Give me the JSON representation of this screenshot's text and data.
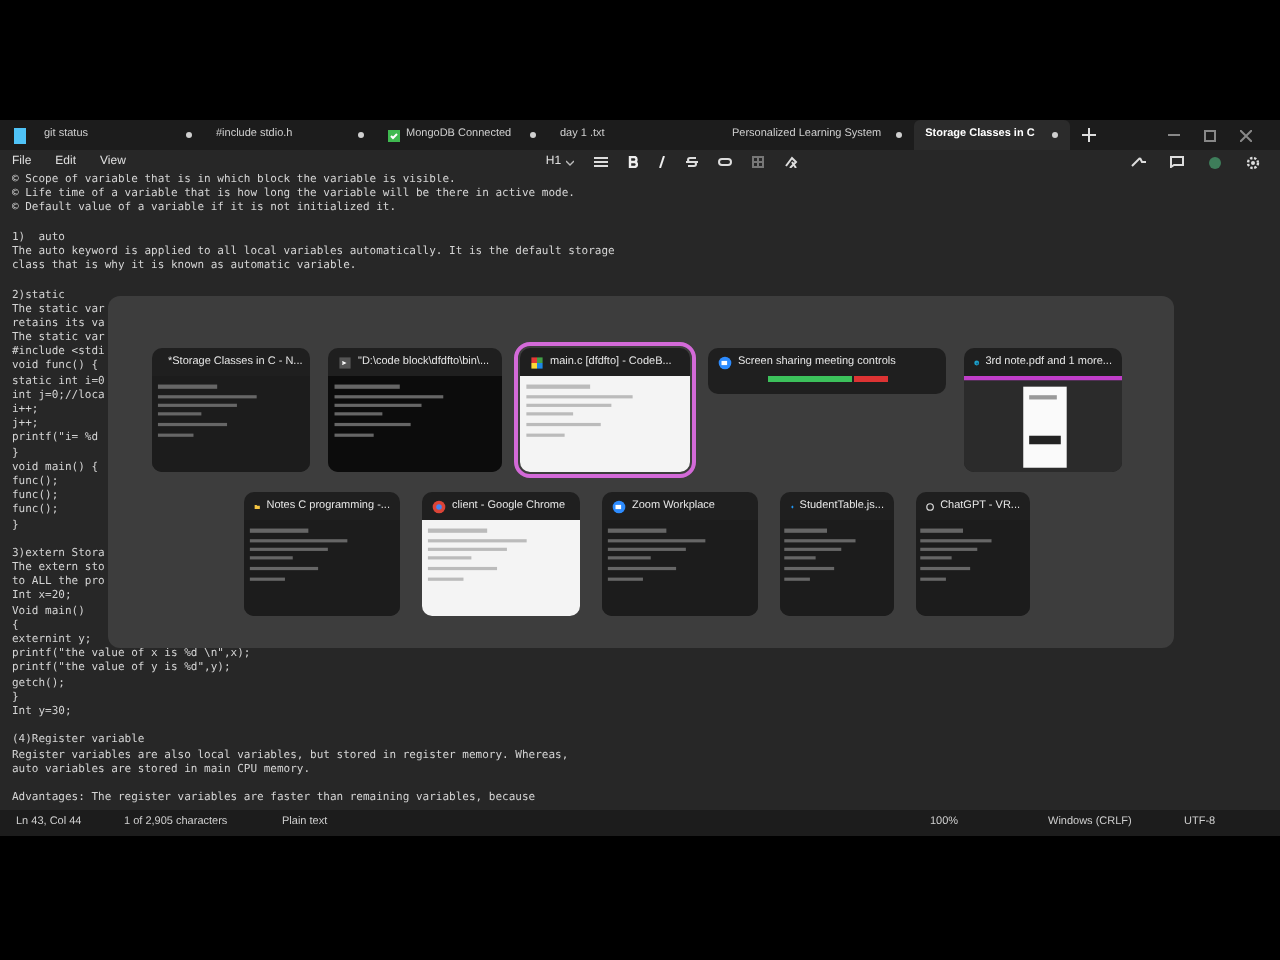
{
  "tabs": [
    {
      "label": "git status",
      "selected": false,
      "modified": true,
      "kind": "plain"
    },
    {
      "label": "#include stdio.h",
      "selected": false,
      "modified": true,
      "kind": "plain"
    },
    {
      "label": "MongoDB Connected",
      "selected": false,
      "modified": true,
      "kind": "check"
    },
    {
      "label": "day 1 .txt",
      "selected": false,
      "modified": false,
      "kind": "plain"
    },
    {
      "label": "Personalized Learning System",
      "selected": false,
      "modified": true,
      "kind": "plain"
    },
    {
      "label": "Storage Classes in C",
      "selected": true,
      "modified": true,
      "kind": "plain"
    }
  ],
  "menu": [
    "File",
    "Edit",
    "View"
  ],
  "toolbar": {
    "heading": "H1"
  },
  "editor_paragraphs": [
    [
      "© Scope of variable that is in which block the variable is visible.",
      "© Life time of a variable that is how long the variable will be there in active mode.",
      "© Default value of a variable if it is not initialized it."
    ],
    [
      "1)  auto",
      "The auto keyword is applied to all local variables automatically. It is the default storage",
      "class that is why it is known as automatic variable."
    ],
    [
      "2)static",
      "The static var",
      "retains its va",
      "The static var",
      "#include <stdi",
      "void func() {",
      "static int i=0",
      "int j=0;//loca",
      "i++;",
      "j++;",
      "printf(\"i= %d",
      "}",
      "void main() {",
      "func();",
      "func();",
      "func();",
      "}"
    ],
    [
      "3)extern Stora",
      "The extern sto",
      "to ALL the pro",
      "Int x=20;",
      "Void main()",
      "{",
      "externint y;",
      "printf(\"the value of x is %d \\n\",x);",
      "printf(\"the value of y is %d\",y);",
      "getch();",
      "}",
      "Int y=30;"
    ],
    [
      "(4)Register variable",
      "Register variables are also local variables, but stored in register memory. Whereas,",
      "auto variables are stored in main CPU memory."
    ],
    [
      "Advantages: The register variables are faster than remaining variables, because"
    ]
  ],
  "switcher": {
    "rows": [
      [
        {
          "title": "*Storage Classes in C - N...",
          "kind": "dark",
          "selected": false
        },
        {
          "title": "\"D:\\code block\\dfdfto\\bin\\...",
          "kind": "black",
          "selected": false
        },
        {
          "title": "main.c [dfdfto] - CodeB...",
          "kind": "light",
          "selected": true
        },
        {
          "title": "Screen sharing meeting controls",
          "kind": "bar",
          "selected": false
        },
        {
          "title": "3rd note.pdf and 1 more...",
          "kind": "pdf",
          "selected": false
        }
      ],
      [
        {
          "title": "Notes C programming -...",
          "kind": "dark",
          "selected": false
        },
        {
          "title": "client - Google Chrome",
          "kind": "light",
          "selected": false
        },
        {
          "title": "Zoom Workplace",
          "kind": "dark",
          "selected": false
        },
        {
          "title": "StudentTable.js...",
          "kind": "dark",
          "selected": false
        },
        {
          "title": "ChatGPT - VR...",
          "kind": "dark",
          "selected": false
        }
      ]
    ]
  },
  "status_bar": {
    "position": "Ln 43, Col 44",
    "characters": "1 of 2,905 characters",
    "format": "Plain text",
    "zoom": "100%",
    "line_ending": "Windows (CRLF)",
    "encoding": "UTF-8"
  }
}
